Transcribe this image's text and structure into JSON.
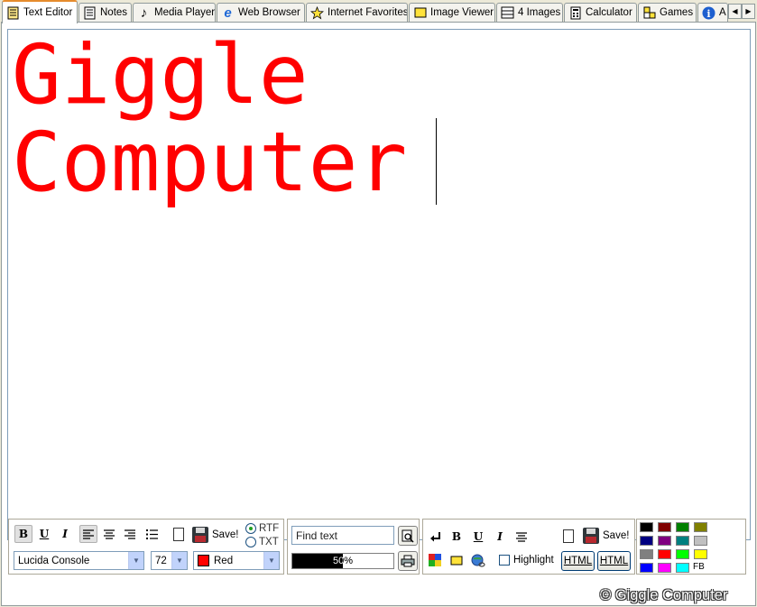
{
  "tabs": [
    {
      "label": "Text Editor",
      "icon": "text-editor-icon",
      "active": true
    },
    {
      "label": "Notes",
      "icon": "notes-icon",
      "active": false
    },
    {
      "label": "Media Player",
      "icon": "music-note-icon",
      "active": false
    },
    {
      "label": "Web Browser",
      "icon": "browser-e-icon",
      "active": false
    },
    {
      "label": "Internet Favorites",
      "icon": "star-icon",
      "active": false
    },
    {
      "label": "Image Viewer",
      "icon": "image-viewer-icon",
      "active": false
    },
    {
      "label": "4 Images",
      "icon": "four-images-icon",
      "active": false
    },
    {
      "label": "Calculator",
      "icon": "calculator-icon",
      "active": false
    },
    {
      "label": "Games",
      "icon": "games-icon",
      "active": false
    },
    {
      "label": "A",
      "icon": "info-icon",
      "active": false
    }
  ],
  "editor": {
    "lines": [
      "Giggle",
      "Computer"
    ],
    "text_color": "#ff0000"
  },
  "format_toolbar": {
    "bold": "B",
    "underline": "U",
    "italic": "I",
    "save_label": "Save!",
    "rtf_label": "RTF",
    "txt_label": "TXT",
    "selected_format": "RTF",
    "font_name": "Lucida Console",
    "font_size": "72",
    "color_name": "Red",
    "color_hex": "#ff0000"
  },
  "find_toolbar": {
    "find_value": "Find text",
    "progress_percent": 50,
    "progress_label": "50%"
  },
  "html_toolbar": {
    "bold": "B",
    "underline": "U",
    "italic": "I",
    "save_label": "Save!",
    "highlight_label": "Highlight",
    "html_button_1": "HTML",
    "html_button_2": "HTML"
  },
  "color_palette": {
    "colors": [
      "#000000",
      "#800000",
      "#008000",
      "#808000",
      "#000080",
      "#800080",
      "#008080",
      "#c0c0c0",
      "#808080",
      "#ff0000",
      "#00ff00",
      "#ffff00",
      "#0000ff",
      "#ff00ff",
      "#00ffff"
    ],
    "extra_label": "FB"
  },
  "copyright": "© Giggle Computer"
}
